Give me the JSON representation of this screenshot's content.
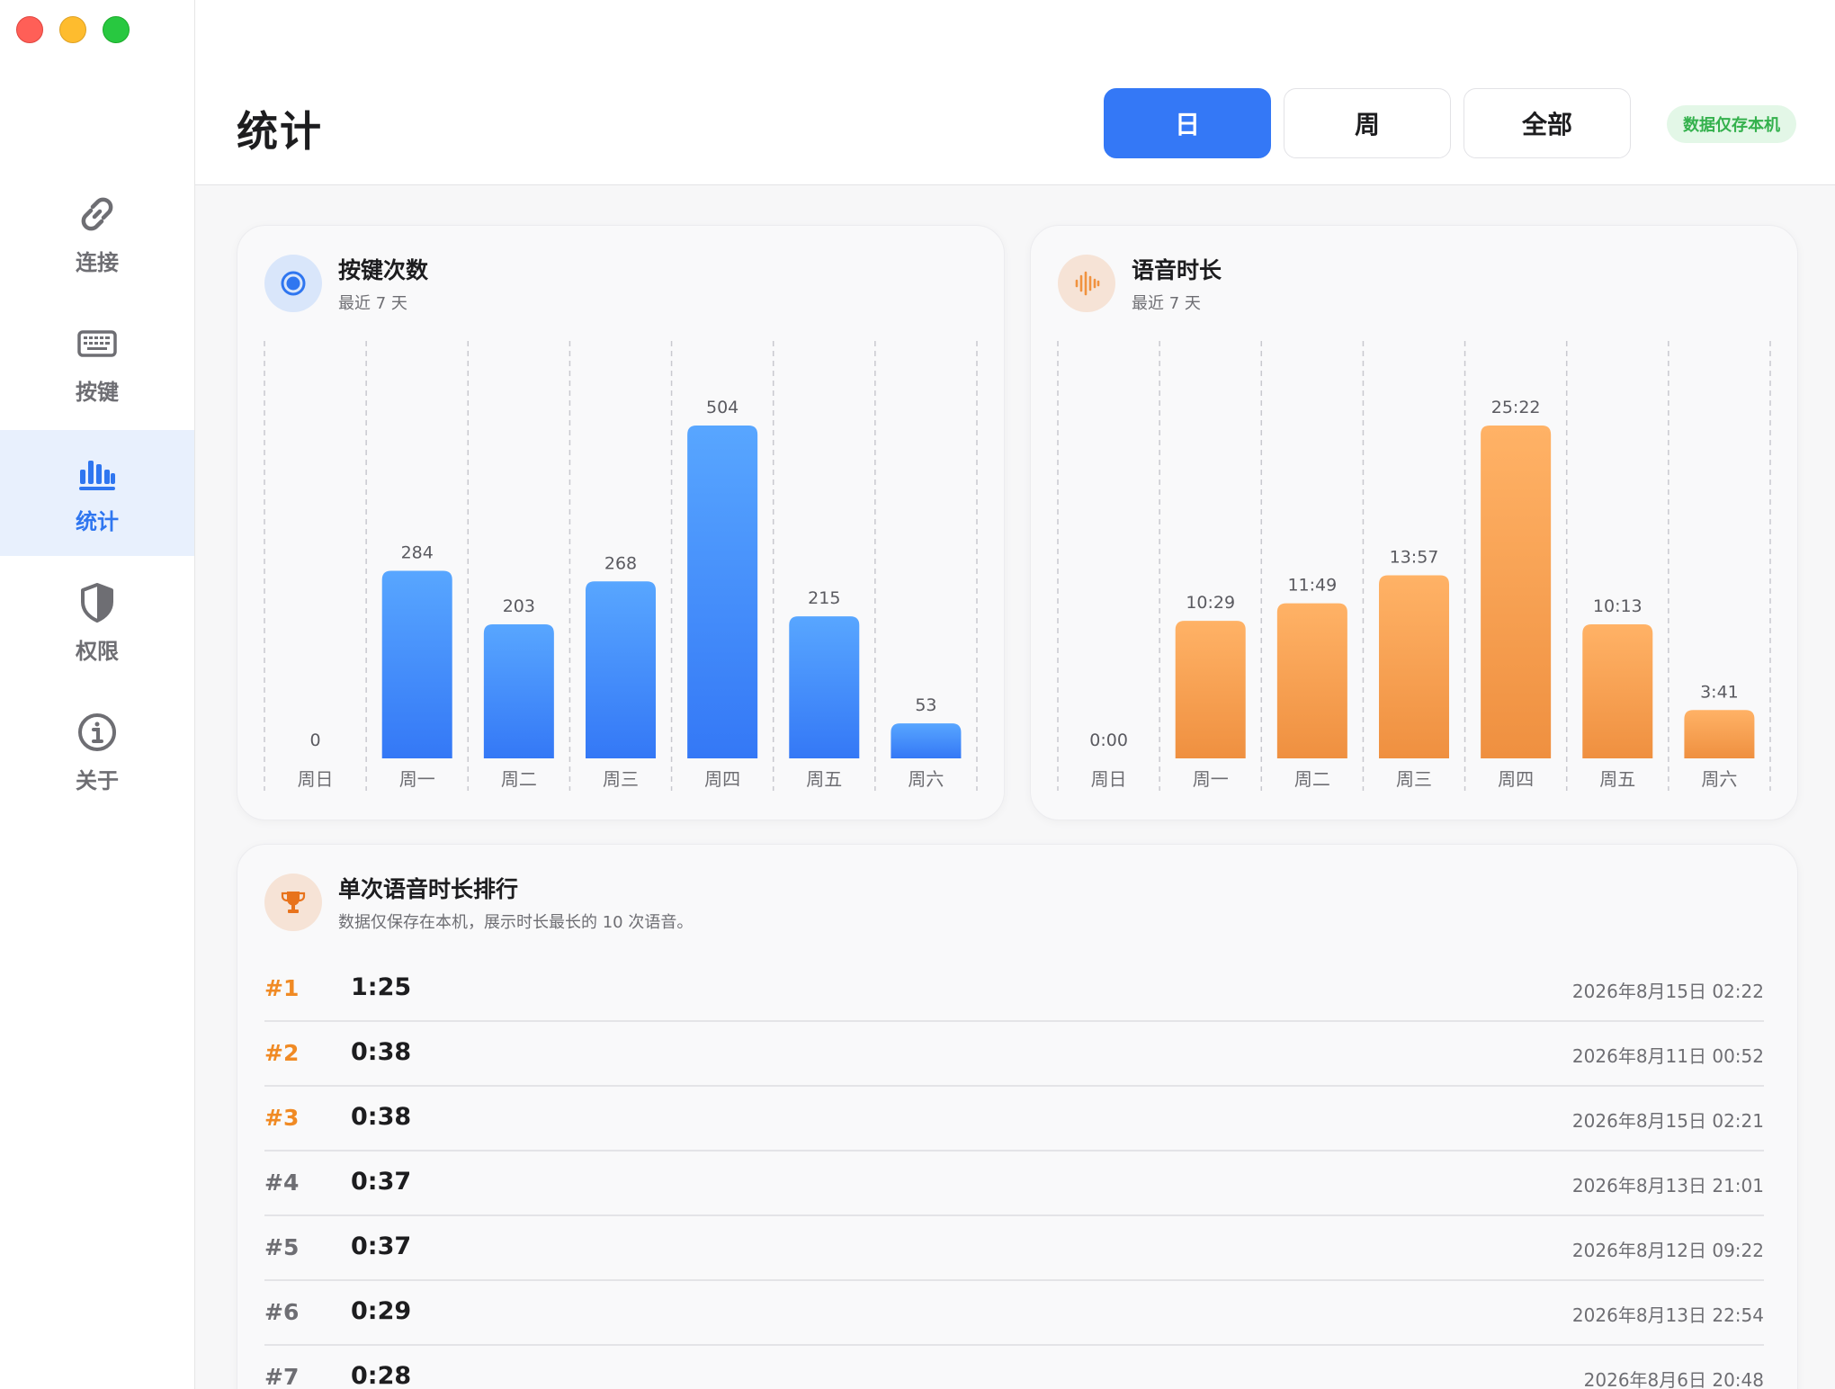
{
  "sidebar": {
    "items": [
      {
        "label": "连接",
        "icon": "link-icon",
        "active": false
      },
      {
        "label": "按键",
        "icon": "keyboard-icon",
        "active": false
      },
      {
        "label": "统计",
        "icon": "bar-chart-icon",
        "active": true
      },
      {
        "label": "权限",
        "icon": "shield-icon",
        "active": false
      },
      {
        "label": "关于",
        "icon": "info-icon",
        "active": false
      }
    ]
  },
  "header": {
    "title": "统计",
    "segments": [
      "日",
      "周",
      "全部"
    ],
    "active_segment": "日",
    "local_badge": "数据仅存本机"
  },
  "keypress_card": {
    "title": "按键次数",
    "subtitle": "最近 7 天",
    "icon": "record-icon",
    "accent": "#3478f6"
  },
  "voice_card": {
    "title": "语音时长",
    "subtitle": "最近 7 天",
    "icon": "waveform-icon",
    "accent": "#f0923f"
  },
  "chart_data": [
    {
      "type": "bar",
      "title": "按键次数",
      "categories": [
        "周日",
        "周一",
        "周二",
        "周三",
        "周四",
        "周五",
        "周六"
      ],
      "values": [
        0,
        284,
        203,
        268,
        504,
        215,
        53
      ],
      "labels": [
        "0",
        "284",
        "203",
        "268",
        "504",
        "215",
        "53"
      ],
      "ylim": [
        0,
        504
      ],
      "grid": "vertical-dashed"
    },
    {
      "type": "bar",
      "title": "语音时长",
      "categories": [
        "周日",
        "周一",
        "周二",
        "周三",
        "周四",
        "周五",
        "周六"
      ],
      "values": [
        0,
        629,
        709,
        837,
        1522,
        613,
        221
      ],
      "labels": [
        "0:00",
        "10:29",
        "11:49",
        "13:57",
        "25:22",
        "10:13",
        "3:41"
      ],
      "ylim": [
        0,
        1522
      ],
      "grid": "vertical-dashed"
    }
  ],
  "ranking": {
    "title": "单次语音时长排行",
    "subtitle": "数据仅保存在本机，展示时长最长的 10 次语音。",
    "icon": "trophy-icon",
    "highlight_color": "#f08a24",
    "rows": [
      {
        "rank": "#1",
        "duration": "1:25",
        "date": "2026年8月15日 02:22"
      },
      {
        "rank": "#2",
        "duration": "0:38",
        "date": "2026年8月11日 00:52"
      },
      {
        "rank": "#3",
        "duration": "0:38",
        "date": "2026年8月15日 02:21"
      },
      {
        "rank": "#4",
        "duration": "0:37",
        "date": "2026年8月13日 21:01"
      },
      {
        "rank": "#5",
        "duration": "0:37",
        "date": "2026年8月12日 09:22"
      },
      {
        "rank": "#6",
        "duration": "0:29",
        "date": "2026年8月13日 22:54"
      },
      {
        "rank": "#7",
        "duration": "0:28",
        "date": "2026年8月6日 20:48"
      }
    ]
  }
}
